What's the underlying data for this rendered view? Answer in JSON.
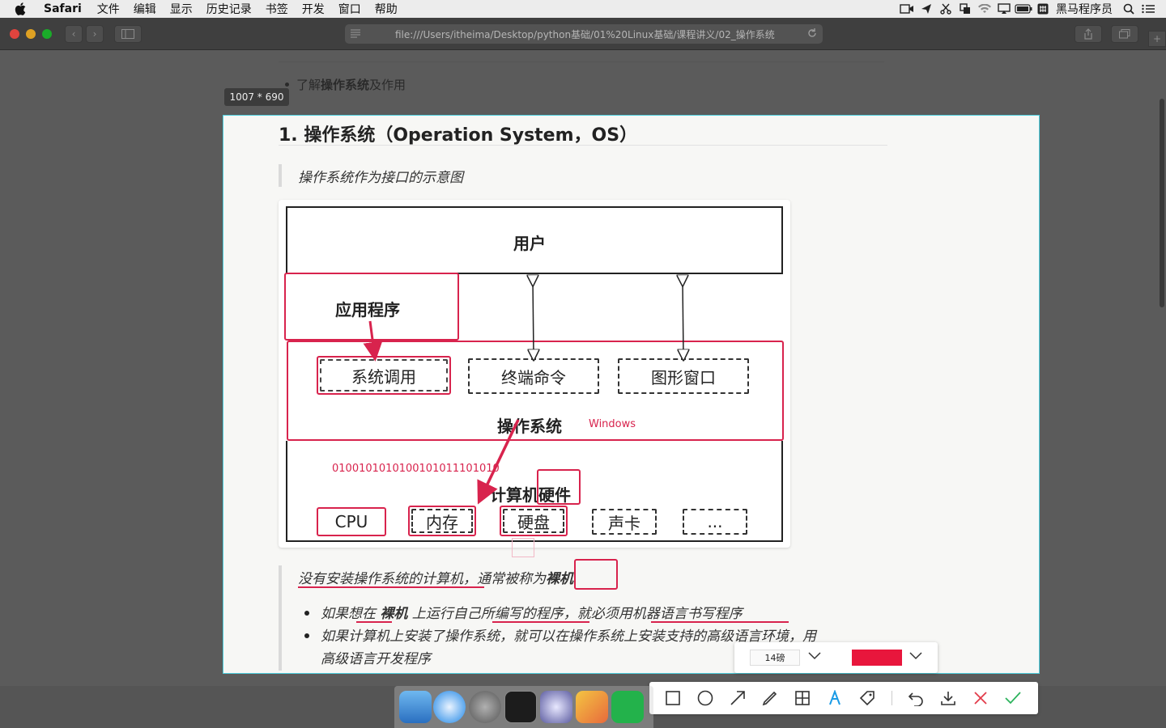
{
  "menubar": {
    "app_name": "Safari",
    "items": [
      "文件",
      "编辑",
      "显示",
      "历史记录",
      "书签",
      "开发",
      "窗口",
      "帮助"
    ],
    "right_text": "黑马程序员"
  },
  "browser": {
    "url": "file:///Users/itheima/Desktop/python基础/01%20Linux基础/课程讲义/02_操作系统"
  },
  "page_bg": {
    "intro_bullet_prefix": "了解",
    "intro_bullet_bold": "操作系统",
    "intro_bullet_suffix": "及作用"
  },
  "capture": {
    "size_label": "1007 * 690"
  },
  "doc": {
    "heading": "1. 操作系统（Operation System，OS）",
    "quote_caption": "操作系统作为接口的示意图",
    "diagram": {
      "user": "用户",
      "app": "应用程序",
      "syscall": "系统调用",
      "terminal": "终端命令",
      "gui": "图形窗口",
      "os": "操作系统",
      "os_note": "Windows",
      "binary_note": "0100101010100101011101010",
      "hardware": "计算机硬件",
      "hw_items": [
        "CPU",
        "内存",
        "硬盘",
        "声卡",
        "..."
      ]
    },
    "bare_line_prefix": "没有安装操作系统的计算机",
    "bare_line_mid": "，通常被称为",
    "bare_line_bold": "裸机",
    "bullets": [
      {
        "a": "如果想在 ",
        "b": "裸机",
        "c": " 上运行自己所编写的程序，就必须用机器语言书写程序"
      },
      {
        "a": "如果计算机上安装了操作系统，就可以在操作系统上安装支持的高级语言环境，用",
        "b": "",
        "c": ""
      }
    ],
    "bullet2_cont": "高级语言开发程序"
  },
  "annot": {
    "font_size": "14磅",
    "color": "#e8163c"
  }
}
